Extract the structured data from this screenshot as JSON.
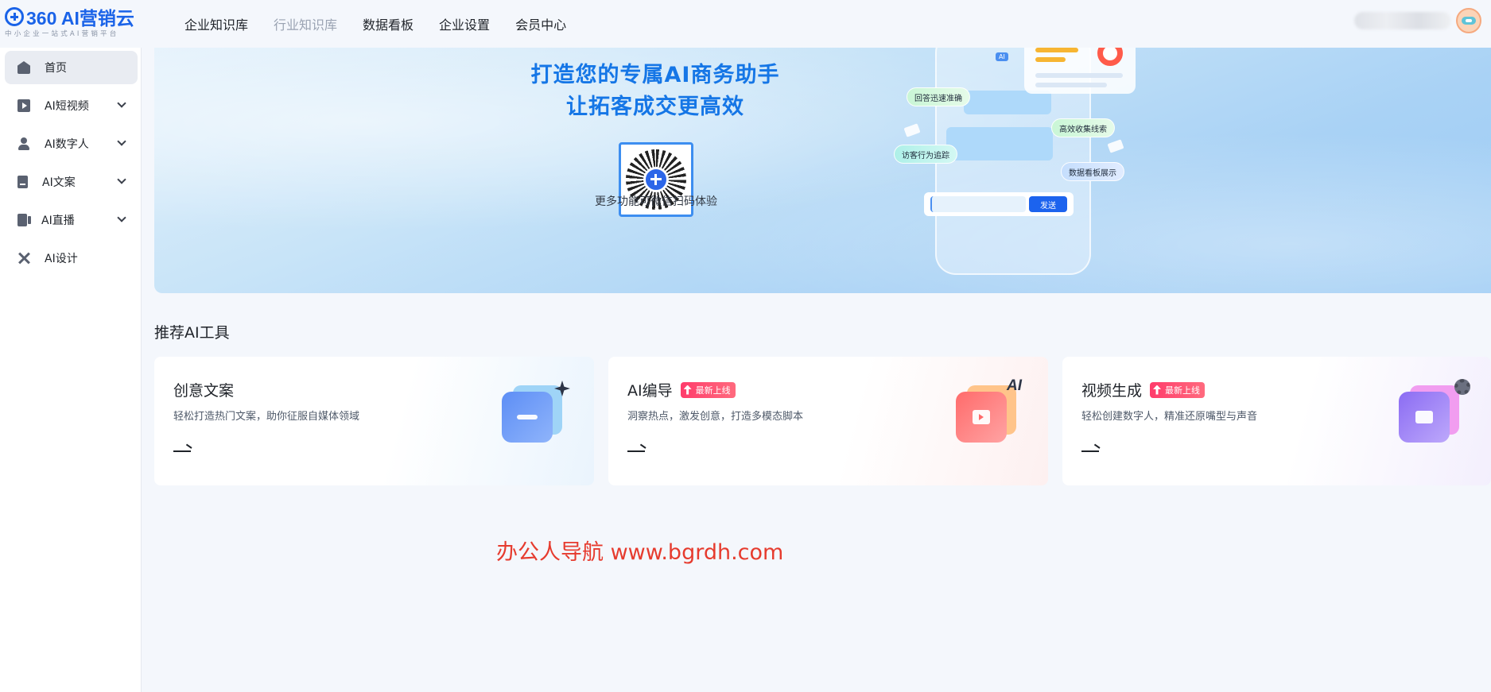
{
  "header": {
    "logo_text": "360 AI营销云",
    "logo_sub": "中小企业一站式AI营销平台",
    "nav": [
      {
        "label": "企业知识库",
        "dim": false
      },
      {
        "label": "行业知识库",
        "dim": true
      },
      {
        "label": "数据看板",
        "dim": false
      },
      {
        "label": "企业设置",
        "dim": false
      },
      {
        "label": "会员中心",
        "dim": false
      }
    ]
  },
  "sidebar": {
    "items": [
      {
        "label": "首页",
        "icon": "home-icon",
        "active": true,
        "expandable": false
      },
      {
        "label": "AI短视频",
        "icon": "video-icon",
        "active": false,
        "expandable": true
      },
      {
        "label": "AI数字人",
        "icon": "person-icon",
        "active": false,
        "expandable": true
      },
      {
        "label": "AI文案",
        "icon": "document-icon",
        "active": false,
        "expandable": true
      },
      {
        "label": "AI直播",
        "icon": "live-icon",
        "active": false,
        "expandable": true
      },
      {
        "label": "AI设计",
        "icon": "design-icon",
        "active": false,
        "expandable": false
      }
    ]
  },
  "banner": {
    "title_line1": "打造您的专属AI商务助手",
    "title_line2": "让拓客成交更高效",
    "qr_caption": "更多功能可微信扫码体验",
    "chips": {
      "fast_answer": "回答迅速准确",
      "visitor_track": "访客行为追踪",
      "lead_collect": "高效收集线索",
      "dashboard": "数据看板展示"
    },
    "ai_tag": "AI",
    "send_label": "发送"
  },
  "section": {
    "title": "推荐AI工具",
    "cards": [
      {
        "title": "创意文案",
        "badge": "",
        "desc": "轻松打造热门文案，助你征服自媒体领域",
        "color": "#6f9bf7"
      },
      {
        "title": "AI编导",
        "badge": "最新上线",
        "desc": "洞察热点，激发创意，打造多模态脚本",
        "color": "#ff7b7b"
      },
      {
        "title": "视频生成",
        "badge": "最新上线",
        "desc": "轻松创建数字人，精准还原嘴型与声音",
        "color": "#a77cf6"
      }
    ]
  },
  "watermark": "办公人导航 www.bgrdh.com",
  "colors": {
    "brand": "#1a63e8",
    "badge": "#ff3c6b",
    "send_button": "#1c63ee",
    "watermark": "#e63b2e"
  }
}
